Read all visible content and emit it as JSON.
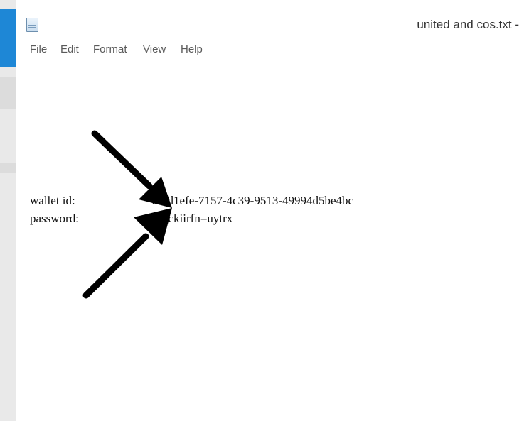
{
  "window": {
    "title": "united and cos.txt -"
  },
  "menu": {
    "items": [
      "File",
      "Edit",
      "Format",
      "View",
      "Help"
    ]
  },
  "content": {
    "wallet_label": "wallet id:",
    "wallet_value": "1c6d1efe-7157-4c39-9513-49994d5be4bc",
    "password_label": "password:",
    "password_value": "hbdckiirfn=uytrx"
  },
  "icons": {
    "app": "notepad-icon",
    "annotation": "arrow-icon"
  },
  "colors": {
    "accent_left": "#1e87d6",
    "arrow": "#000000"
  }
}
